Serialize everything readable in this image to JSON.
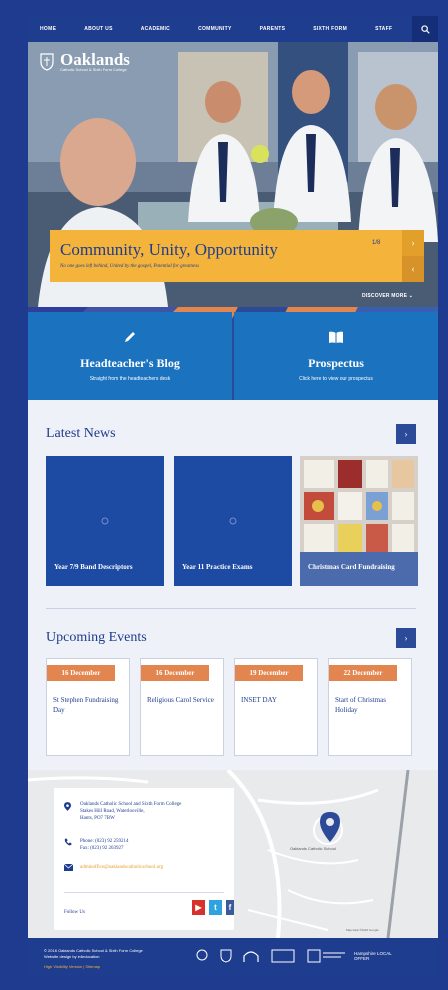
{
  "nav": {
    "items": [
      "HOME",
      "ABOUT US",
      "ACADEMIC",
      "COMMUNITY",
      "PARENTS",
      "SIXTH FORM",
      "STAFF"
    ],
    "search_icon": "search-icon"
  },
  "hero": {
    "logo_name": "Oaklands",
    "logo_subtitle": "Catholic School & Sixth Form College",
    "banner_title": "Community, Unity, Opportunity",
    "banner_subtitle": "No one goes left behind, United by the gospel, Potential for greatness",
    "counter": "1/8",
    "discover_label": "DISCOVER MORE"
  },
  "cta": {
    "blog_title": "Headteacher's Blog",
    "blog_subtitle": "Straight from the headteachers desk",
    "prospectus_title": "Prospectus",
    "prospectus_subtitle": "Click here to view our prospectus"
  },
  "news": {
    "title": "Latest News",
    "items": [
      "Year 7/9 Band Descriptors",
      "Year 11 Practice Exams",
      "Christmas Card Fundraising"
    ]
  },
  "events": {
    "title": "Upcoming Events",
    "items": [
      {
        "date": "16 December",
        "title": "St Stephen Fundraising Day"
      },
      {
        "date": "16 December",
        "title": "Religious Carol Service"
      },
      {
        "date": "19 December",
        "title": "INSET DAY"
      },
      {
        "date": "22 December",
        "title": "Start of Christmas Holiday"
      }
    ]
  },
  "contact": {
    "address_line1": "Oaklands Catholic School and Sixth Form College",
    "address_line2": "Stakes Hill Road, Waterlooville,",
    "address_line3": "Hants, PO7 7BW",
    "phone": "Phone: (023) 92 259214",
    "fax": "Fax: (023) 92 263927",
    "email": "adminoffice@oaklandscatholicschool.org",
    "follow_label": "Follow Us",
    "map_place": "Oaklands Catholic School",
    "map_credit": "Map data ©2016 Google"
  },
  "footer": {
    "copyright": "© 2016 Oaklands Catholic School & Sixth Form College",
    "credit": "Website design by e4education",
    "links": "High Visibility Version  |  Sitemap",
    "partner_local_offer": "Hampshire LOCAL OFFER"
  },
  "colors": {
    "navy": "#1f3d8e",
    "blue": "#1b73bf",
    "yellow": "#f4b43b",
    "orange": "#e2854f"
  }
}
